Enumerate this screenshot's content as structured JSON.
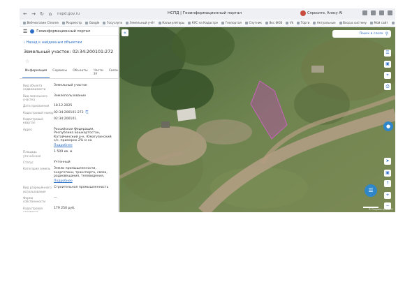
{
  "browser": {
    "url": "nspd.gov.ru",
    "page_title": "НСПД | Геоинформационный портал",
    "profile_name": "Спросите, Алису AI",
    "bookmarks": [
      "Веб-магазин Chrome",
      "Росреестр",
      "Google",
      "Госуслуги",
      "Земельный учёт",
      "Калькуляторы",
      "КУС на Кадастре",
      "Геопортал",
      "Спутник",
      "Вкс ФОБ",
      "Vk",
      "Торги",
      "Актуальные",
      "Вход в систему",
      "Мой сайт",
      "Ещё"
    ]
  },
  "sidebar": {
    "portal_name": "Геоинформационный портал",
    "back_link": "Назад к найденным объектам",
    "title": "Земельный участок: 02:34:200101:272",
    "tabs": [
      "Информация",
      "Сервисы",
      "Объекты",
      "Части ЗУ",
      "Связи"
    ],
    "active_tab": 0,
    "properties": [
      {
        "key": "Вид объекта недвижимости",
        "value": "Земельный участок"
      },
      {
        "key": "Вид земельного участка",
        "value": "Землепользование"
      },
      {
        "key": "Дата присвоения",
        "value": "18.12.2025"
      },
      {
        "key": "Кадастровый номер",
        "value": "02:34:200101:272"
      },
      {
        "key": "Кадастровый квартал",
        "value": "02:34:200101"
      },
      {
        "key": "Адрес",
        "value": "Российская Федерация, Республика Башкортостан, Катайчинский р-н, Юмагузинский с/с, примерно 2% м на",
        "more": "Подробнее"
      },
      {
        "key": "Площадь уточнённая",
        "value": "1 509 кв. м"
      },
      {
        "key": "Статус",
        "value": "Учтенный"
      },
      {
        "key": "Категория земель",
        "value": "Земли промышленности, энергетики, транспорта, связи, радиовещания, телевидения,",
        "more": "Подробнее"
      },
      {
        "key": "Вид разрешённого использования",
        "value": "Строительная промышленность"
      },
      {
        "key": "Форма собственности",
        "value": "—"
      },
      {
        "key": "Кадастровая стоимость",
        "value": "179 250 руб."
      }
    ]
  },
  "map": {
    "search_label": "Поиск в слоях",
    "collapse_icon": "chevron-left-icon",
    "attribution": "© Росреестр 2023",
    "parcel_color": "#b64fa8",
    "chat_color": "#2f86c9"
  }
}
